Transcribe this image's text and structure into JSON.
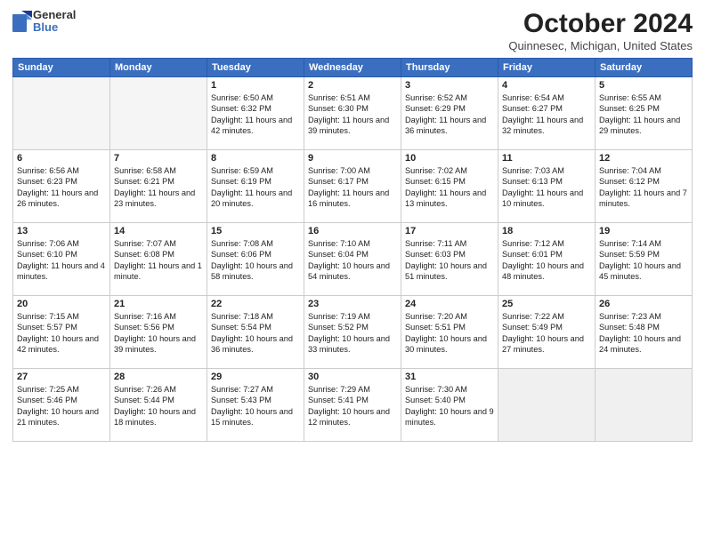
{
  "header": {
    "logo": {
      "line1": "General",
      "line2": "Blue"
    },
    "title": "October 2024",
    "location": "Quinnesec, Michigan, United States"
  },
  "weekdays": [
    "Sunday",
    "Monday",
    "Tuesday",
    "Wednesday",
    "Thursday",
    "Friday",
    "Saturday"
  ],
  "weeks": [
    [
      {
        "day": "",
        "info": "",
        "empty": true
      },
      {
        "day": "",
        "info": "",
        "empty": true
      },
      {
        "day": "1",
        "info": "Sunrise: 6:50 AM\nSunset: 6:32 PM\nDaylight: 11 hours and 42 minutes."
      },
      {
        "day": "2",
        "info": "Sunrise: 6:51 AM\nSunset: 6:30 PM\nDaylight: 11 hours and 39 minutes."
      },
      {
        "day": "3",
        "info": "Sunrise: 6:52 AM\nSunset: 6:29 PM\nDaylight: 11 hours and 36 minutes."
      },
      {
        "day": "4",
        "info": "Sunrise: 6:54 AM\nSunset: 6:27 PM\nDaylight: 11 hours and 32 minutes."
      },
      {
        "day": "5",
        "info": "Sunrise: 6:55 AM\nSunset: 6:25 PM\nDaylight: 11 hours and 29 minutes."
      }
    ],
    [
      {
        "day": "6",
        "info": "Sunrise: 6:56 AM\nSunset: 6:23 PM\nDaylight: 11 hours and 26 minutes."
      },
      {
        "day": "7",
        "info": "Sunrise: 6:58 AM\nSunset: 6:21 PM\nDaylight: 11 hours and 23 minutes."
      },
      {
        "day": "8",
        "info": "Sunrise: 6:59 AM\nSunset: 6:19 PM\nDaylight: 11 hours and 20 minutes."
      },
      {
        "day": "9",
        "info": "Sunrise: 7:00 AM\nSunset: 6:17 PM\nDaylight: 11 hours and 16 minutes."
      },
      {
        "day": "10",
        "info": "Sunrise: 7:02 AM\nSunset: 6:15 PM\nDaylight: 11 hours and 13 minutes."
      },
      {
        "day": "11",
        "info": "Sunrise: 7:03 AM\nSunset: 6:13 PM\nDaylight: 11 hours and 10 minutes."
      },
      {
        "day": "12",
        "info": "Sunrise: 7:04 AM\nSunset: 6:12 PM\nDaylight: 11 hours and 7 minutes."
      }
    ],
    [
      {
        "day": "13",
        "info": "Sunrise: 7:06 AM\nSunset: 6:10 PM\nDaylight: 11 hours and 4 minutes."
      },
      {
        "day": "14",
        "info": "Sunrise: 7:07 AM\nSunset: 6:08 PM\nDaylight: 11 hours and 1 minute."
      },
      {
        "day": "15",
        "info": "Sunrise: 7:08 AM\nSunset: 6:06 PM\nDaylight: 10 hours and 58 minutes."
      },
      {
        "day": "16",
        "info": "Sunrise: 7:10 AM\nSunset: 6:04 PM\nDaylight: 10 hours and 54 minutes."
      },
      {
        "day": "17",
        "info": "Sunrise: 7:11 AM\nSunset: 6:03 PM\nDaylight: 10 hours and 51 minutes."
      },
      {
        "day": "18",
        "info": "Sunrise: 7:12 AM\nSunset: 6:01 PM\nDaylight: 10 hours and 48 minutes."
      },
      {
        "day": "19",
        "info": "Sunrise: 7:14 AM\nSunset: 5:59 PM\nDaylight: 10 hours and 45 minutes."
      }
    ],
    [
      {
        "day": "20",
        "info": "Sunrise: 7:15 AM\nSunset: 5:57 PM\nDaylight: 10 hours and 42 minutes."
      },
      {
        "day": "21",
        "info": "Sunrise: 7:16 AM\nSunset: 5:56 PM\nDaylight: 10 hours and 39 minutes."
      },
      {
        "day": "22",
        "info": "Sunrise: 7:18 AM\nSunset: 5:54 PM\nDaylight: 10 hours and 36 minutes."
      },
      {
        "day": "23",
        "info": "Sunrise: 7:19 AM\nSunset: 5:52 PM\nDaylight: 10 hours and 33 minutes."
      },
      {
        "day": "24",
        "info": "Sunrise: 7:20 AM\nSunset: 5:51 PM\nDaylight: 10 hours and 30 minutes."
      },
      {
        "day": "25",
        "info": "Sunrise: 7:22 AM\nSunset: 5:49 PM\nDaylight: 10 hours and 27 minutes."
      },
      {
        "day": "26",
        "info": "Sunrise: 7:23 AM\nSunset: 5:48 PM\nDaylight: 10 hours and 24 minutes."
      }
    ],
    [
      {
        "day": "27",
        "info": "Sunrise: 7:25 AM\nSunset: 5:46 PM\nDaylight: 10 hours and 21 minutes."
      },
      {
        "day": "28",
        "info": "Sunrise: 7:26 AM\nSunset: 5:44 PM\nDaylight: 10 hours and 18 minutes."
      },
      {
        "day": "29",
        "info": "Sunrise: 7:27 AM\nSunset: 5:43 PM\nDaylight: 10 hours and 15 minutes."
      },
      {
        "day": "30",
        "info": "Sunrise: 7:29 AM\nSunset: 5:41 PM\nDaylight: 10 hours and 12 minutes."
      },
      {
        "day": "31",
        "info": "Sunrise: 7:30 AM\nSunset: 5:40 PM\nDaylight: 10 hours and 9 minutes."
      },
      {
        "day": "",
        "info": "",
        "empty": true,
        "shaded": true
      },
      {
        "day": "",
        "info": "",
        "empty": true,
        "shaded": true
      }
    ]
  ]
}
